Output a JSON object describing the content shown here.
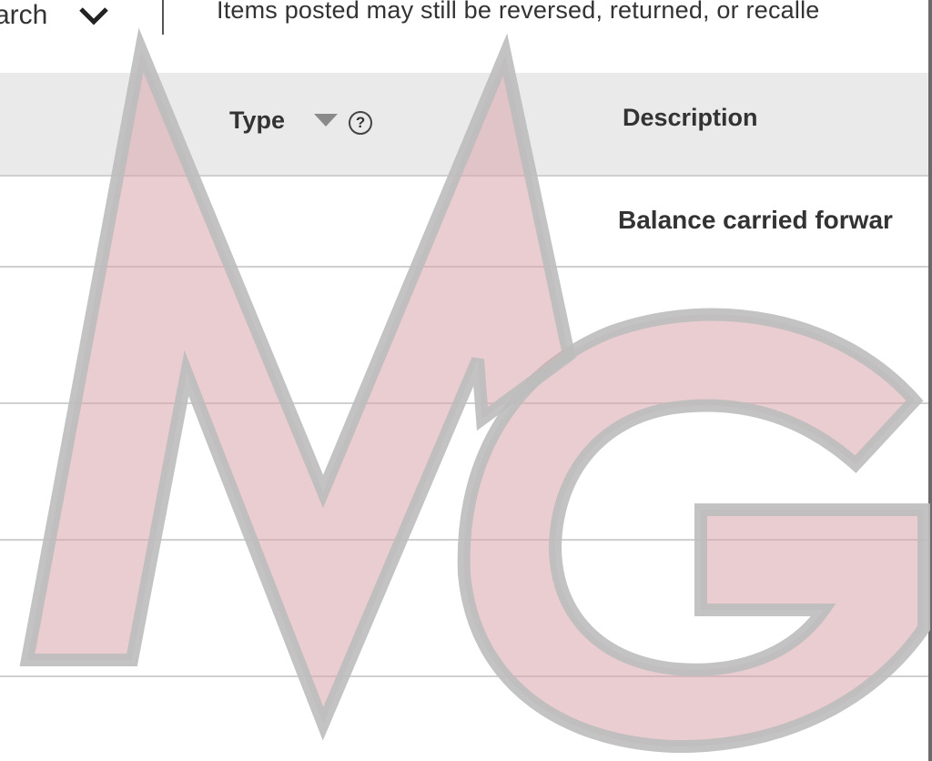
{
  "toolbar": {
    "search_label": "arch",
    "chevron_icon": "chevron-down-icon",
    "notice": "Items posted may still be reversed, returned, or recalle"
  },
  "table": {
    "columns": [
      {
        "label": "Type",
        "sort_icon": "sort-desc-icon",
        "help_icon": "?"
      },
      {
        "label": "Description"
      }
    ],
    "rows": [
      {
        "description": "Balance carried forwar"
      },
      {
        "description": ""
      },
      {
        "description": ""
      },
      {
        "description": ""
      },
      {
        "description": ""
      }
    ]
  },
  "watermark": {
    "fill_color": "#d9a4aa",
    "outline_color": "#bdbdbd"
  }
}
